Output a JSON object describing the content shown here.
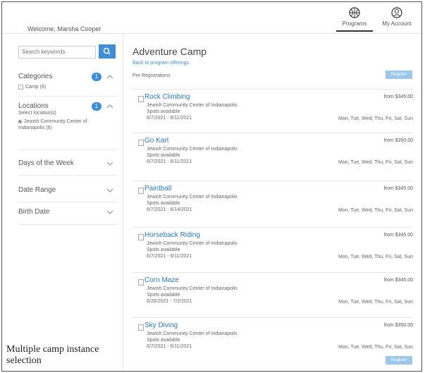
{
  "header": {
    "welcome": "Welcome, Marsha Cooper",
    "nav": [
      {
        "label": "Programs",
        "icon": "basketball-icon"
      },
      {
        "label": "My Account",
        "icon": "account-icon"
      }
    ]
  },
  "sidebar": {
    "search": {
      "placeholder": "Search keywords"
    },
    "categories": {
      "title": "Categories",
      "count": "1",
      "items": [
        "Camp (6)"
      ]
    },
    "locations": {
      "title": "Locations",
      "count": "1",
      "subtitle": "Select location(s)",
      "items": [
        "Jewish Community Center of Indianapolis (6)"
      ]
    },
    "collapsed": [
      {
        "title": "Days of the Week"
      },
      {
        "title": "Date Range"
      },
      {
        "title": "Birth Date"
      }
    ]
  },
  "caption": "Multiple camp instance selection",
  "main": {
    "title": "Adventure Camp",
    "back_link": "Back to program offerings",
    "filter_label": "Pre Registrations",
    "top_button": "Register",
    "bottom_button": "Register",
    "camps": [
      {
        "name": "Rock Climbing",
        "price": "from $345.00",
        "venue": "Jewish Community Center of Indianapolis",
        "spots": "Spots available",
        "dates": "6/7/2021 - 6/11/2021",
        "days": "Mon, Tue, Wed, Thu, Fri, Sat, Sun"
      },
      {
        "name": "Go Kart",
        "price": "from $350.00",
        "venue": "Jewish Community Center of Indianapolis",
        "spots": "Spots available",
        "dates": "6/7/2021 - 6/11/2021",
        "days": "Mon, Tue, Wed, Thu, Fri, Sat, Sun"
      },
      {
        "name": "Paintball",
        "price": "from $345.00",
        "venue": "Jewish Community Center of Indianapolis",
        "spots": "Spots available",
        "dates": "6/7/2021 - 6/14/2021",
        "days": "Mon, Tue, Wed, Thu, Fri, Sat, Sun"
      },
      {
        "name": "Horseback Riding",
        "price": "from $345.00",
        "venue": "Jewish Community Center of Indianapolis",
        "spots": "Spots available",
        "dates": "6/7/2021 - 6/11/2021",
        "days": "Mon, Tue, Wed, Thu, Fri, Sat, Sun"
      },
      {
        "name": "Corn Maze",
        "price": "from $345.00",
        "venue": "Jewish Community Center of Indianapolis",
        "spots": "Spots available",
        "dates": "6/28/2021 - 7/2/2021",
        "days": "Mon, Tue, Wed, Thu, Fri, Sat, Sun"
      },
      {
        "name": "Sky Diving",
        "price": "from $350.00",
        "venue": "Jewish Community Center of Indianapolis",
        "spots": "Spots available",
        "dates": "6/7/2021 - 6/11/2021",
        "days": "Mon, Tue, Wed, Thu, Fri, Sat, Sun"
      }
    ]
  }
}
